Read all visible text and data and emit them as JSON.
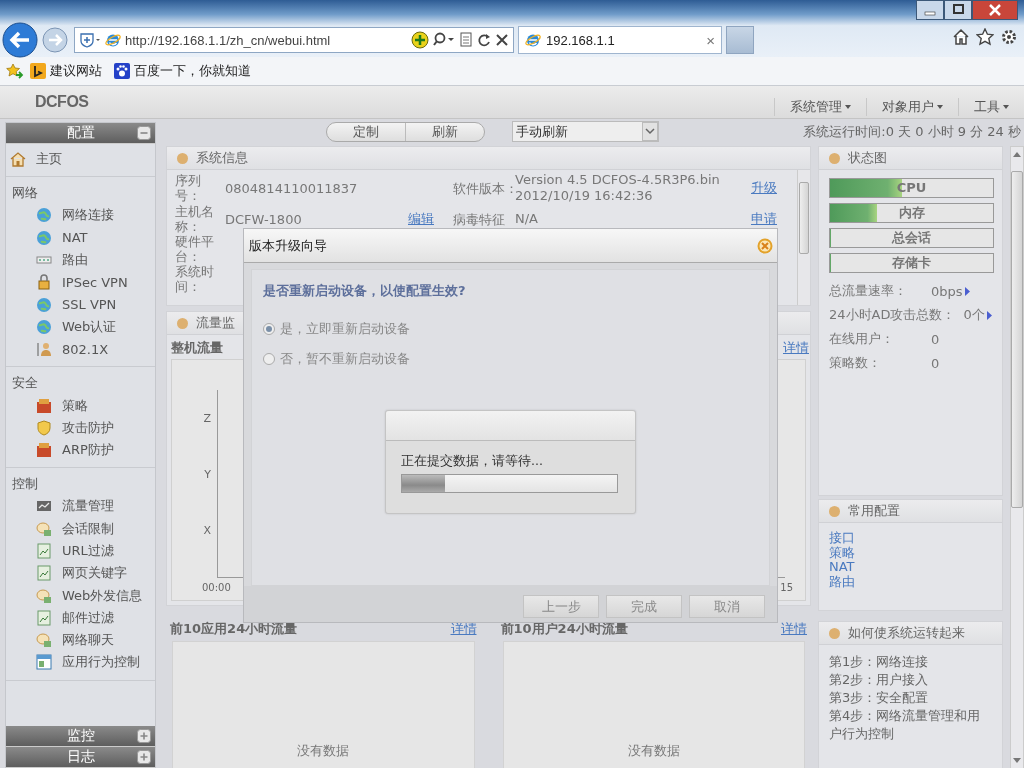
{
  "browser": {
    "address": "http://192.168.1.1/zh_cn/webui.html",
    "tab": {
      "title": "192.168.1.1",
      "close": "×"
    }
  },
  "favorites": [
    "建议网站",
    "百度一下，你就知道"
  ],
  "app": {
    "logo": "DCFOS",
    "menus": [
      "系统管理",
      "对象用户",
      "工具"
    ]
  },
  "sidebar": {
    "sections": [
      {
        "title": "配置",
        "expanded": true,
        "groups": [
          {
            "items": [
              "主页"
            ]
          },
          {
            "title": "网络",
            "items": [
              "网络连接",
              "NAT",
              "路由",
              "IPSec VPN",
              "SSL VPN",
              "Web认证",
              "802.1X"
            ]
          },
          {
            "title": "安全",
            "items": [
              "策略",
              "攻击防护",
              "ARP防护"
            ]
          },
          {
            "title": "控制",
            "items": [
              "流量管理",
              "会话限制",
              "URL过滤",
              "网页关键字",
              "Web外发信息",
              "邮件过滤",
              "网络聊天",
              "应用行为控制"
            ]
          }
        ]
      },
      {
        "title": "监控",
        "expanded": false
      },
      {
        "title": "日志",
        "expanded": false
      }
    ]
  },
  "toolbar": {
    "buttons": [
      "定制",
      "刷新"
    ],
    "refresh_mode": "手动刷新",
    "uptime": "系统运行时间:0 天 0 小时 9 分 24 秒"
  },
  "system_info": {
    "title": "系统信息",
    "rows": [
      {
        "label": "序列号：",
        "value": "0804814110011837",
        "label_2": "软件版本：",
        "value_2": "Version 4.5 DCFOS-4.5R3P6.bin 2012/10/19 16:42:36",
        "link_2": "升级"
      },
      {
        "label": "主机名称：",
        "value": "DCFW-1800",
        "link": "编辑",
        "label_2": "病毒特征",
        "value_2": "N/A",
        "link_2": "申请"
      },
      {
        "label": "硬件平台："
      },
      {
        "label": "系统时间："
      }
    ]
  },
  "traffic": {
    "title": "流量监",
    "chart_title": "整机流量",
    "details": "详情",
    "y_labels": [
      "Z",
      "Y",
      "X"
    ],
    "x_labels": [
      "00:00",
      "15"
    ]
  },
  "top_panels": [
    {
      "title": "前10应用24小时流量",
      "details": "详情",
      "empty": "没有数据"
    },
    {
      "title": "前10用户24小时流量",
      "details": "详情",
      "empty": "没有数据"
    }
  ],
  "status": {
    "title": "状态图",
    "bars": [
      {
        "label": "CPU",
        "level": 0.44
      },
      {
        "label": "内存",
        "level": 0.29
      },
      {
        "label": "总会话",
        "level": 0
      },
      {
        "label": "存储卡",
        "level": 0
      }
    ],
    "stats": [
      {
        "label": "总流量速率：",
        "value": "0bps",
        "more": true
      },
      {
        "label": "24小时AD攻击总数：",
        "value": "0个",
        "more": true
      },
      {
        "label": "在线用户：",
        "value": "0",
        "more": false
      },
      {
        "label": "策略数：",
        "value": "0",
        "more": false
      }
    ]
  },
  "common_config": {
    "title": "常用配置",
    "links": [
      "接口",
      "策略",
      "NAT",
      "路由"
    ]
  },
  "guide": {
    "title": "如何使系统运转起来",
    "steps": [
      "第1步：网络连接",
      "第2步：用户接入",
      "第3步：安全配置",
      "第4步：网络流量管理和用户行为控制"
    ]
  },
  "dialog": {
    "title": "版本升级向导",
    "question": "是否重新启动设备，以使配置生效?",
    "options": [
      {
        "label": "是，立即重新启动设备",
        "selected": true
      },
      {
        "label": "否，暂不重新启动设备",
        "selected": false
      }
    ],
    "progress": {
      "message": "正在提交数据，请等待...",
      "level": 0.2
    },
    "buttons": [
      "上一步",
      "完成",
      "取消"
    ]
  }
}
